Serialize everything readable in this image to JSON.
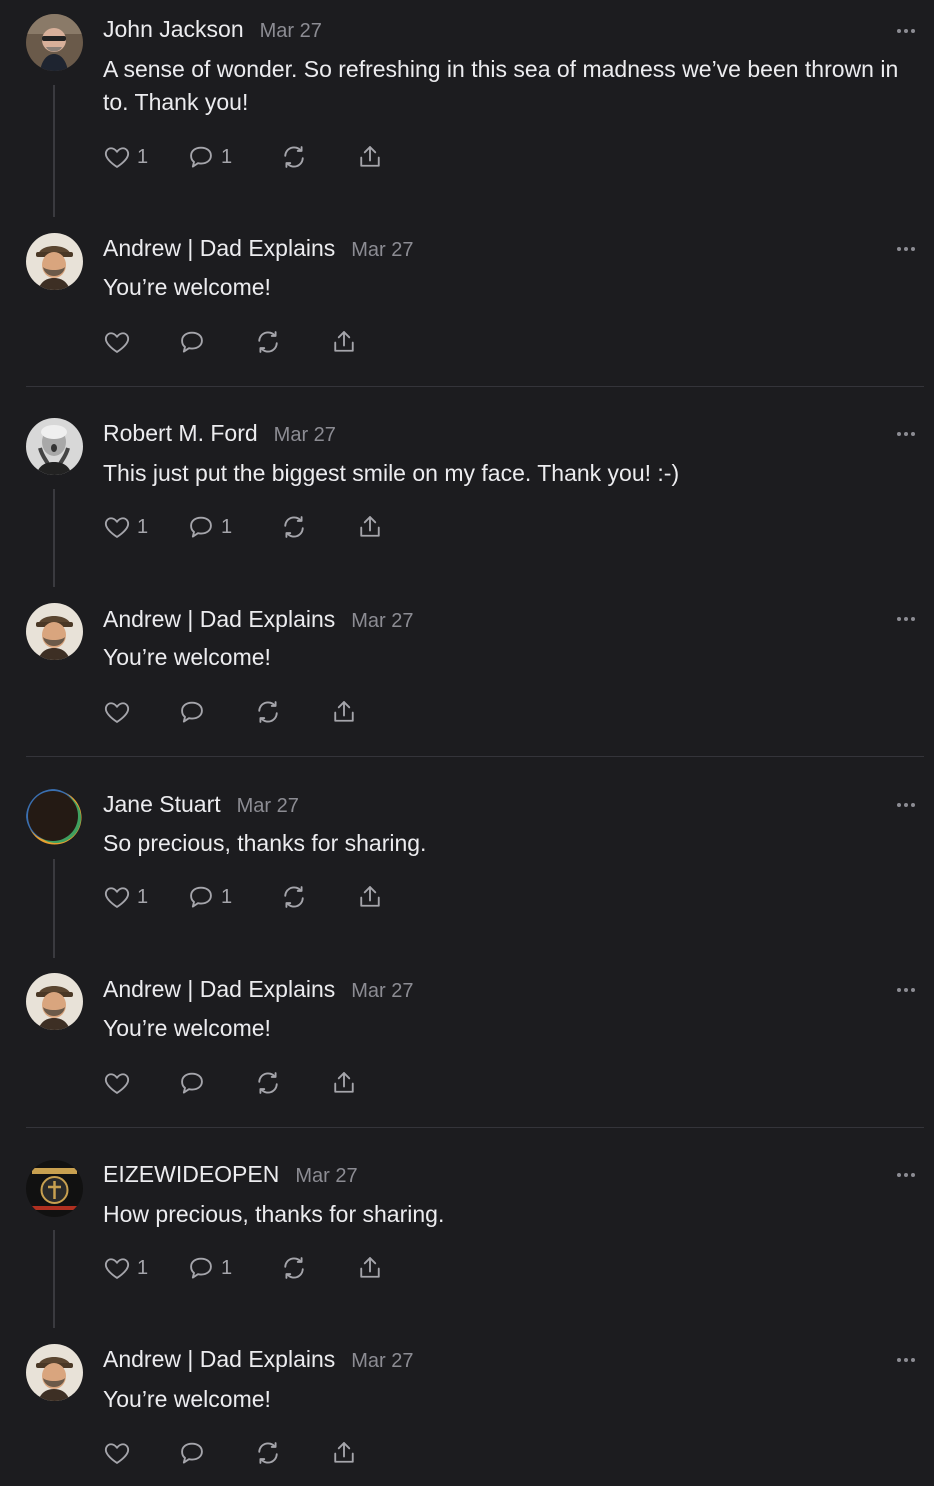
{
  "comments": [
    {
      "author": "John Jackson",
      "date": "Mar 27",
      "text": "A sense of wonder. So refreshing in this sea of madness we’ve been thrown in to. Thank you!",
      "likes": "1",
      "replies": "1"
    },
    {
      "author": "Andrew | Dad Explains",
      "date": "Mar 27",
      "text": "You’re welcome!"
    },
    {
      "author": "Robert M. Ford",
      "date": "Mar 27",
      "text": "This just put the biggest smile on my face. Thank you! :-)",
      "likes": "1",
      "replies": "1"
    },
    {
      "author": "Andrew | Dad Explains",
      "date": "Mar 27",
      "text": "You’re welcome!"
    },
    {
      "author": "Jane Stuart",
      "date": "Mar 27",
      "text": "So precious, thanks for sharing.",
      "likes": "1",
      "replies": "1"
    },
    {
      "author": "Andrew | Dad Explains",
      "date": "Mar 27",
      "text": "You’re welcome!"
    },
    {
      "author": "EIZEWIDEOPEN",
      "date": "Mar 27",
      "text": "How precious, thanks for sharing.",
      "likes": "1",
      "replies": "1"
    },
    {
      "author": "Andrew | Dad Explains",
      "date": "Mar 27",
      "text": "You’re welcome!"
    }
  ],
  "icons": [
    "heart-icon",
    "comment-icon",
    "restack-icon",
    "share-icon",
    "more-icon"
  ],
  "colors": {
    "background": "#1c1c1f",
    "text": "#ececef",
    "muted": "#8c8c93"
  }
}
